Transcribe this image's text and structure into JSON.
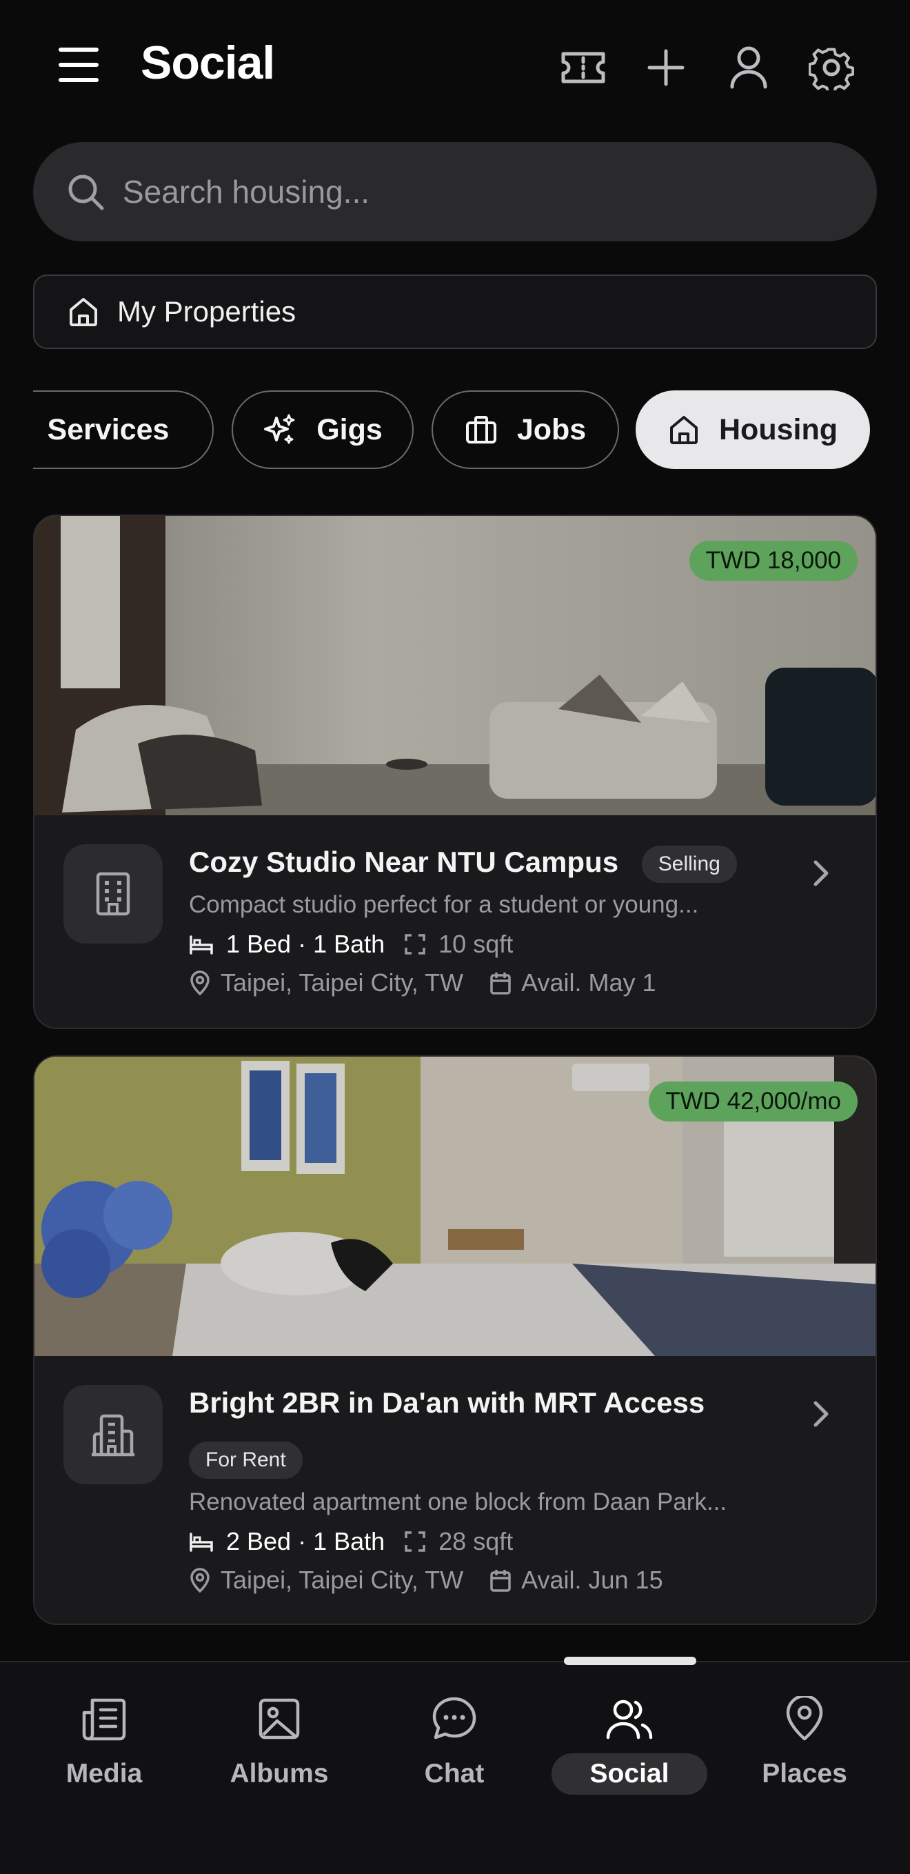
{
  "header": {
    "title": "Social"
  },
  "search": {
    "placeholder": "Search housing..."
  },
  "my_properties": {
    "label": "My Properties"
  },
  "chips": [
    {
      "label": "Services",
      "icon": "clipboard-icon"
    },
    {
      "label": "Gigs",
      "icon": "sparkles-icon"
    },
    {
      "label": "Jobs",
      "icon": "briefcase-icon"
    },
    {
      "label": "Housing",
      "icon": "home-icon",
      "active": true
    }
  ],
  "listings": [
    {
      "price": "TWD 18,000",
      "title": "Cozy Studio Near NTU Campus",
      "badge": "Selling",
      "description": "Compact studio perfect for a student or young...",
      "beds_baths": "1 Bed · 1 Bath",
      "size": "10 sqft",
      "location": "Taipei, Taipei City, TW",
      "available": "Avail. May 1"
    },
    {
      "price": "TWD 42,000/mo",
      "title": "Bright 2BR in Da'an with MRT Access",
      "badge": "For Rent",
      "description": "Renovated apartment one block from Daan Park...",
      "beds_baths": "2 Bed · 1 Bath",
      "size": "28 sqft",
      "location": "Taipei, Taipei City, TW",
      "available": "Avail. Jun 15"
    }
  ],
  "nav": [
    {
      "label": "Media"
    },
    {
      "label": "Albums"
    },
    {
      "label": "Chat"
    },
    {
      "label": "Social",
      "active": true
    },
    {
      "label": "Places"
    }
  ],
  "colors": {
    "price_badge": "#5da35c",
    "background": "#0a0a0b",
    "card": "#1a1a1c"
  }
}
